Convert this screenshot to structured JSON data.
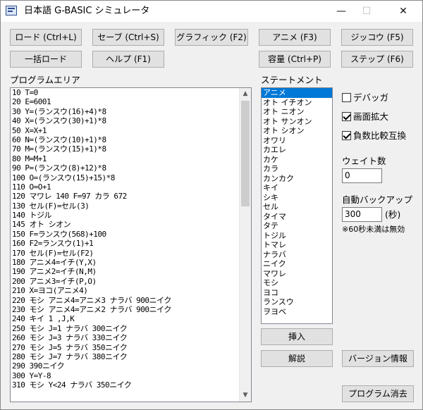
{
  "window": {
    "title": "日本語 G-BASIC シミュレータ",
    "controls": {
      "minimize": "—",
      "maximize": "☐",
      "close": "✕"
    }
  },
  "toolbar": {
    "load": "ロード (Ctrl+L)",
    "save": "セーブ (Ctrl+S)",
    "graphic": "グラフィック (F2)",
    "anime": "アニメ (F3)",
    "jikkou": "ジッコウ (F5)",
    "bulk_load": "一括ロード",
    "help": "ヘルプ (F1)",
    "capacity": "容量 (Ctrl+P)",
    "step": "ステップ (F6)"
  },
  "program_area": {
    "label": "プログラムエリア",
    "lines": [
      "10 T=0",
      "20 E=6001",
      "30 Y=(ランスウ(16)+4)*8",
      "40 X=(ランスウ(30)+1)*8",
      "50 X=X+1",
      "60 N=(ランスウ(10)+1)*8",
      "70 M=(ランスウ(15)+1)*8",
      "80 M=M+1",
      "90 P=(ランスウ(8)+12)*8",
      "100 O=(ランスウ(15)+15)*8",
      "110 O=O+1",
      "120 マワレ 140 F=97 カラ 672",
      "130 セル(F)=セル(3)",
      "140 トジル",
      "145 オト シオン",
      "150 F=ランスウ(568)+100",
      "160 F2=ランスウ(1)+1",
      "170 セル(F)=セル(F2)",
      "180 アニメ4=イチ(Y,X)",
      "190 アニメ2=イチ(N,M)",
      "200 アニメ3=イチ(P,O)",
      "210 X=ヨコ(アニメ4)",
      "220 モシ アニメ4=アニメ3 ナラバ 900ニイク",
      "230 モシ アニメ4=アニメ2 ナラバ 900ニイク",
      "240 キイ 1 ,J,K",
      "250 モシ J=1 ナラバ 300ニイク",
      "260 モシ J=3 ナラバ 330ニイク",
      "270 モシ J=5 ナラバ 350ニイク",
      "280 モシ J=7 ナラバ 380ニイク",
      "290 390ニイク",
      "300 Y=Y-8",
      "310 モシ Y<24 ナラバ 350ニイク"
    ]
  },
  "statements": {
    "label": "ステートメント",
    "selected_index": 0,
    "items": [
      "アニメ",
      "オト イチオン",
      "オト ニオン",
      "オト サンオン",
      "オト シオン",
      "オワリ",
      "カエレ",
      "カケ",
      "カラ",
      "カンカク",
      "キイ",
      "シキ",
      "セル",
      "タイマ",
      "タテ",
      "トジル",
      "トマレ",
      "ナラバ",
      "ニイク",
      "マワレ",
      "モシ",
      "ヨコ",
      "ランスウ",
      "ヲヨベ"
    ]
  },
  "options": {
    "debugger": {
      "label": "デバッガ",
      "checked": false
    },
    "zoom": {
      "label": "画面拡大",
      "checked": true
    },
    "negative_compare": {
      "label": "負数比較互換",
      "checked": true
    },
    "wait_label": "ウェイト数",
    "wait_value": "0",
    "autobackup_label": "自動バックアップ",
    "autobackup_value": "300",
    "autobackup_unit": "(秒)",
    "autobackup_note": "※60秒未満は無効"
  },
  "actions": {
    "insert": "挿入",
    "explain": "解説",
    "version": "バージョン情報",
    "erase": "プログラム消去"
  },
  "icons": {
    "scroll_up": "▲",
    "scroll_down": "▼",
    "app_icon": "window-app-icon"
  }
}
